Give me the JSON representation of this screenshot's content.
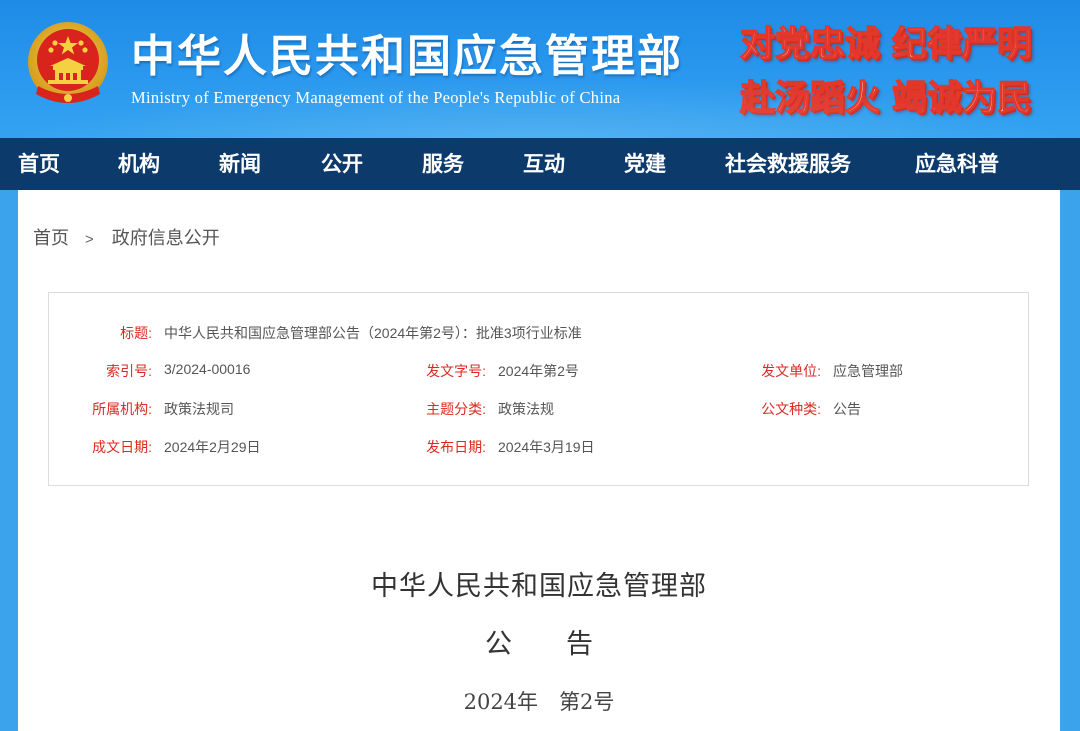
{
  "header": {
    "title": "中华人民共和国应急管理部",
    "subtitle": "Ministry of Emergency Management of the People's Republic of China",
    "slogan_line1": [
      "对党忠诚",
      "纪律严明"
    ],
    "slogan_line2": [
      "赴汤蹈火",
      "竭诚为民"
    ],
    "emblem_icon": "national-emblem-icon"
  },
  "colors": {
    "header_blue": "#2a98ee",
    "nav_navy": "#0c3a6b",
    "label_red": "#d92b21",
    "slogan_red": "#e2372b"
  },
  "nav": {
    "items": [
      "首页",
      "机构",
      "新闻",
      "公开",
      "服务",
      "互动",
      "党建",
      "社会救援服务",
      "应急科普"
    ]
  },
  "breadcrumb": {
    "home": "首页",
    "separator": ">",
    "current": "政府信息公开"
  },
  "info": {
    "title_label": "标题:",
    "title_value": "中华人民共和国应急管理部公告（2024年第2号）：批准3项行业标准",
    "index_label": "索引号:",
    "index_value": "3/2024-00016",
    "doc_no_label": "发文字号:",
    "doc_no_value": "2024年第2号",
    "issuer_label": "发文单位:",
    "issuer_value": "应急管理部",
    "org_label": "所属机构:",
    "org_value": "政策法规司",
    "topic_label": "主题分类:",
    "topic_value": "政策法规",
    "type_label": "公文种类:",
    "type_value": "公告",
    "created_label": "成文日期:",
    "created_value": "2024年2月29日",
    "published_label": "发布日期:",
    "published_value": "2024年3月19日"
  },
  "document": {
    "org": "中华人民共和国应急管理部",
    "kind": "公　　告",
    "number": "2024年　第2号"
  }
}
